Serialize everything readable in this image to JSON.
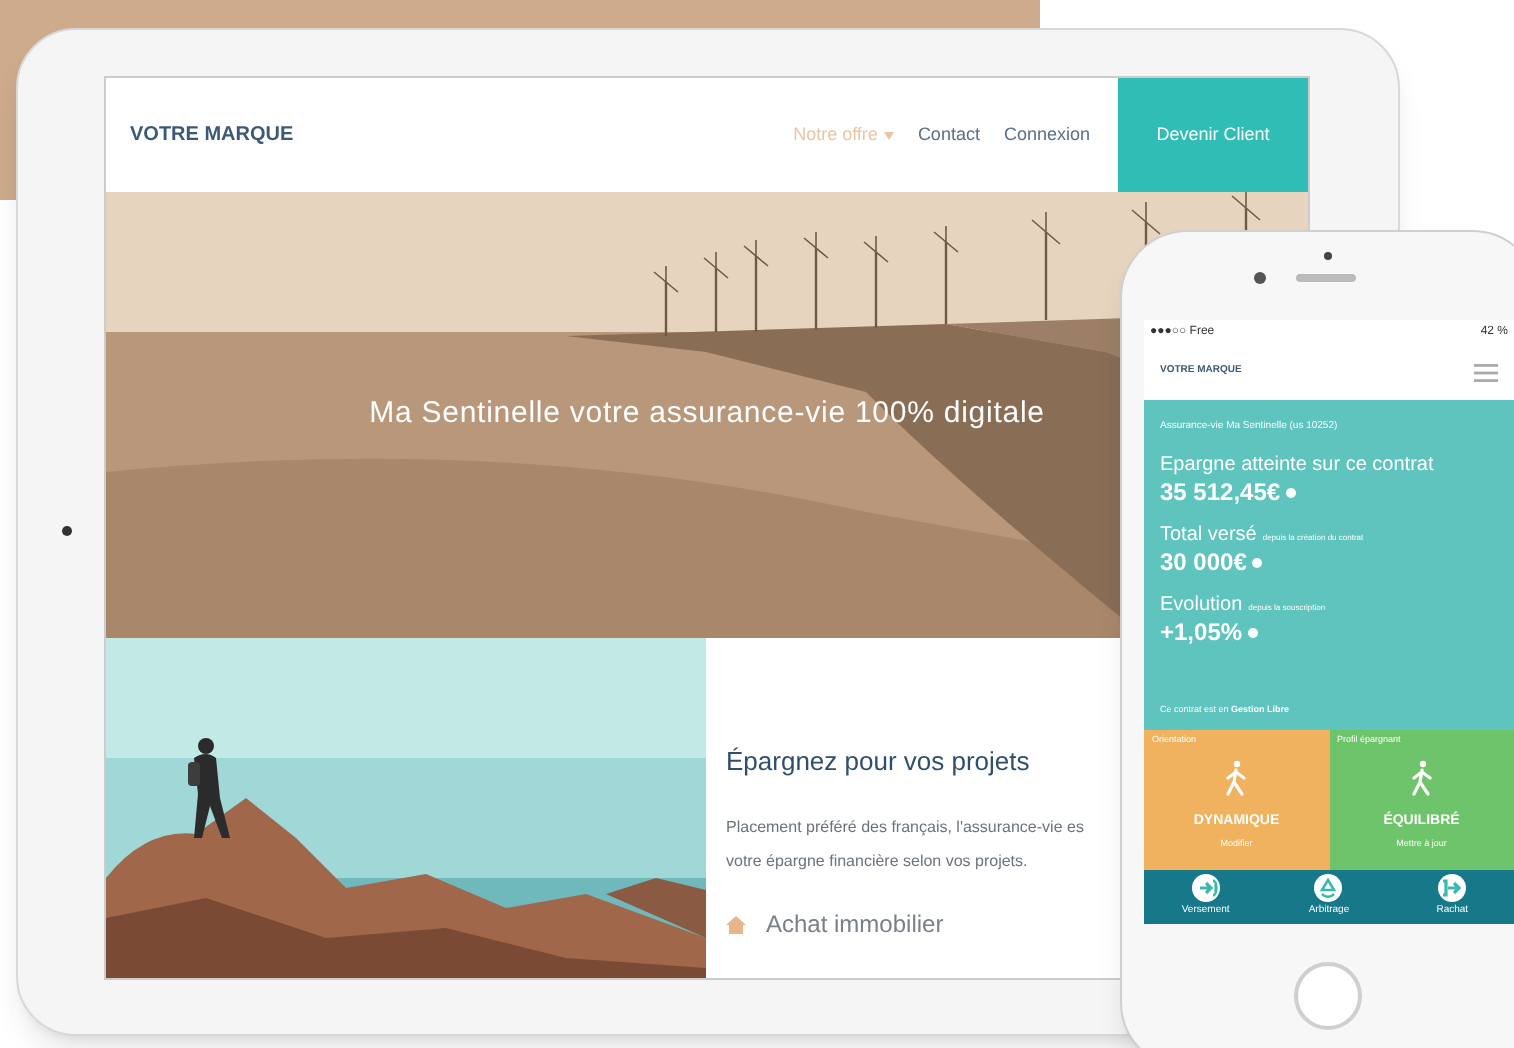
{
  "tablet": {
    "brand": "VOTRE MARQUE",
    "nav": [
      {
        "label": "Notre offre",
        "dropdown": true,
        "selected": true
      },
      {
        "label": "Contact",
        "dropdown": false,
        "selected": false
      },
      {
        "label": "Connexion",
        "dropdown": false,
        "selected": false
      }
    ],
    "cta": "Devenir Client",
    "hero": {
      "kind": "picture",
      "headline": "Ma Sentinelle votre assurance-vie 100% digitale"
    },
    "section": {
      "title": "Épargnez pour vos projets",
      "lines": [
        "Placement préféré des français, l'assurance-vie es",
        "votre épargne financière selon vos projets."
      ],
      "items": [
        "Achat immobilier"
      ]
    }
  },
  "phone": {
    "status": {
      "carrier": "●●●○○ Free",
      "battery": "42 %"
    },
    "brand": "VOTRE MARQUE",
    "contract": "Assurance-vie Ma Sentinelle (us 10252)",
    "stats": [
      {
        "label": "Epargne atteinte sur ce contrat",
        "value": "35 512,45€"
      },
      {
        "label": "Total versé",
        "note": "depuis la création du contrat",
        "value": "30 000€"
      },
      {
        "label": "Evolution",
        "note": "depuis la souscription",
        "value": "+1,05%"
      }
    ],
    "mode": {
      "text": "Ce contrat est en",
      "value": "Gestion Libre"
    },
    "tiles": [
      {
        "caption": "Orientation",
        "title": "DYNAMIQUE",
        "action": "Modifier",
        "color": "#f0b25e"
      },
      {
        "caption": "Profil épargnant",
        "title": "ÉQUILIBRÉ",
        "action": "Mettre à jour",
        "color": "#6ec46a"
      }
    ],
    "actions": [
      {
        "kind": "in",
        "label": "Versement"
      },
      {
        "kind": "swap",
        "label": "Arbitrage"
      },
      {
        "kind": "out",
        "label": "Rachat"
      }
    ]
  }
}
